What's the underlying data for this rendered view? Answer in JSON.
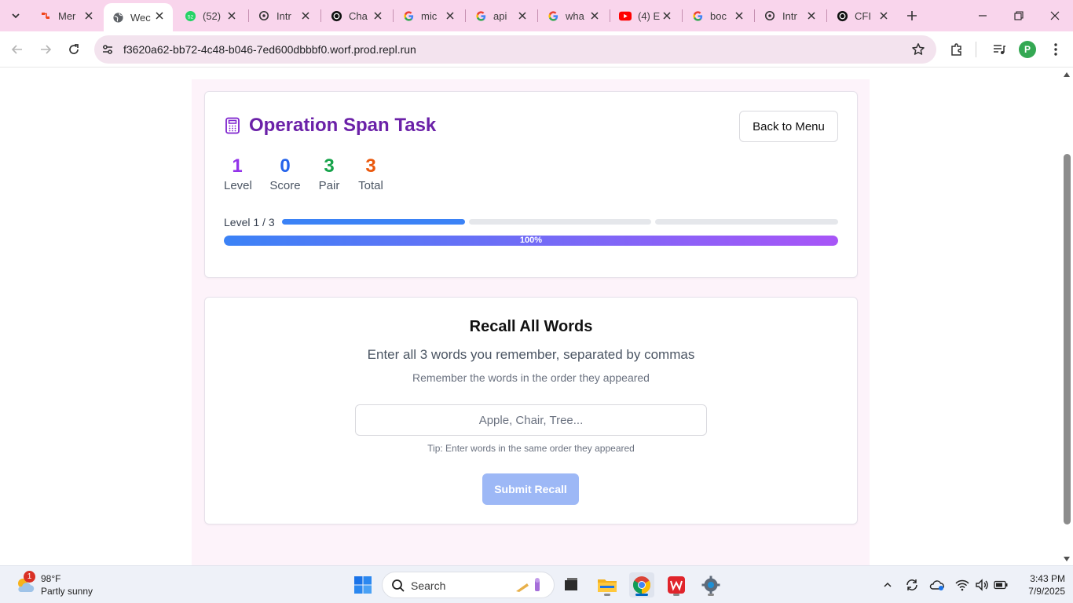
{
  "browser": {
    "tabs": [
      {
        "title": "Mer",
        "icon": "app-icon"
      },
      {
        "title": "Wec",
        "icon": "globe-icon",
        "active": true
      },
      {
        "title": "(52)",
        "icon": "whatsapp-icon"
      },
      {
        "title": "Intr",
        "icon": "openai-icon"
      },
      {
        "title": "Cha",
        "icon": "chatgpt-icon"
      },
      {
        "title": "mic",
        "icon": "google-icon"
      },
      {
        "title": "api",
        "icon": "google-icon"
      },
      {
        "title": "wha",
        "icon": "google-icon"
      },
      {
        "title": "(4) E",
        "icon": "youtube-icon"
      },
      {
        "title": "boc",
        "icon": "google-icon"
      },
      {
        "title": "Intr",
        "icon": "openai-icon"
      },
      {
        "title": "CFI",
        "icon": "chatgpt-icon"
      }
    ],
    "url": "f3620a62-bb72-4c48-b046-7ed600dbbbf0.worf.prod.repl.run",
    "profile_initial": "P"
  },
  "app": {
    "title": "Operation Span Task",
    "back_button": "Back to Menu",
    "stats": [
      {
        "value": "1",
        "label": "Level",
        "color": "#9333ea"
      },
      {
        "value": "0",
        "label": "Score",
        "color": "#2563eb"
      },
      {
        "value": "3",
        "label": "Pair",
        "color": "#16a34a"
      },
      {
        "value": "3",
        "label": "Total",
        "color": "#ea580c"
      }
    ],
    "level_text": "Level 1 / 3",
    "level_segments": {
      "current": 1,
      "total": 3
    },
    "progress_percent": 100,
    "progress_label": "100%"
  },
  "recall": {
    "title": "Recall All Words",
    "instruction": "Enter all 3 words you remember, separated by commas",
    "hint": "Remember the words in the order they appeared",
    "input_placeholder": "Apple, Chair, Tree...",
    "input_value": "",
    "tip": "Tip: Enter words in the same order they appeared",
    "submit_label": "Submit Recall"
  },
  "taskbar": {
    "weather_temp": "98°F",
    "weather_condition": "Partly sunny",
    "weather_badge": "1",
    "search_label": "Search",
    "time": "3:43 PM",
    "date": "7/9/2025"
  },
  "colors": {
    "title_purple": "#6b21a8",
    "tabstrip_pink": "#f9d5ec",
    "progress_blue": "#3b82f6",
    "progress_purple": "#a855f7",
    "submit_disabled": "#9db8f6"
  }
}
